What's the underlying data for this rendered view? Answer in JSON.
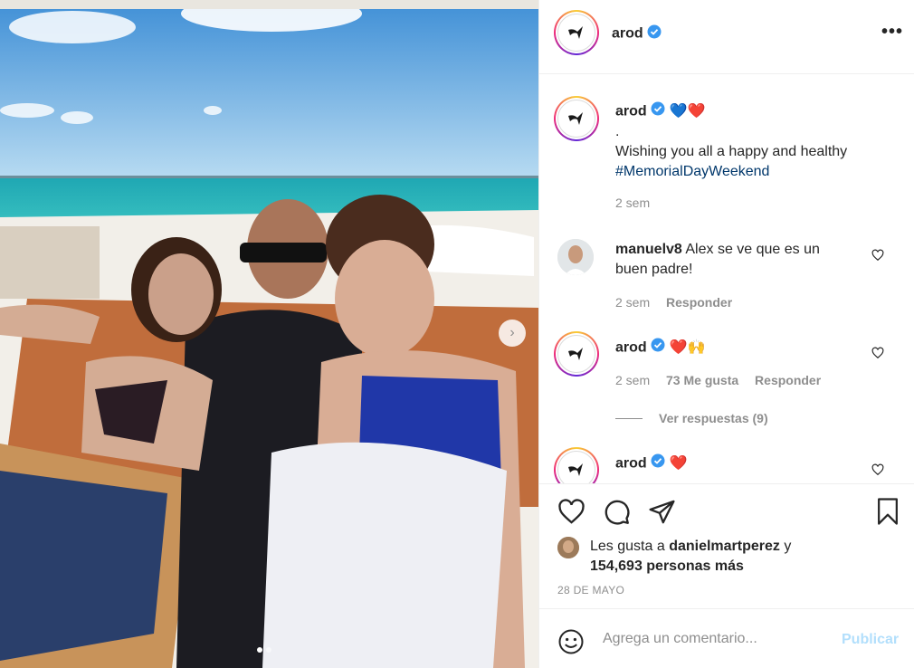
{
  "post": {
    "username": "arod",
    "more_label": "•••",
    "carousel": {
      "dots": 2,
      "active_index": 0
    }
  },
  "caption": {
    "username": "arod",
    "emojis": [
      "💙",
      "❤️"
    ],
    "line1": ".",
    "line2": "Wishing you all a happy and healthy",
    "hashtag": "#MemorialDayWeekend",
    "time": "2 sem"
  },
  "comments": [
    {
      "username": "manuelv8",
      "text": "Alex se ve que es un",
      "text2": "buen padre!",
      "time": "2 sem",
      "reply": "Responder"
    },
    {
      "username": "arod",
      "emojis": "❤️🙌",
      "time": "2 sem",
      "likes": "73 Me gusta",
      "reply": "Responder",
      "view_replies": "Ver respuestas (9)"
    },
    {
      "username": "arod",
      "emojis": "❤️"
    }
  ],
  "likes": {
    "prefix": "Les gusta a",
    "user": "danielmartperez",
    "joiner": "y",
    "others": "154,693 personas más"
  },
  "date": "28 DE MAYO",
  "comment_box": {
    "placeholder": "Agrega un comentario...",
    "publish": "Publicar"
  },
  "colors": {
    "verified": "#3897f0",
    "link": "#00376b",
    "muted": "#8e8e8e",
    "publish_disabled": "#b2dffc"
  }
}
